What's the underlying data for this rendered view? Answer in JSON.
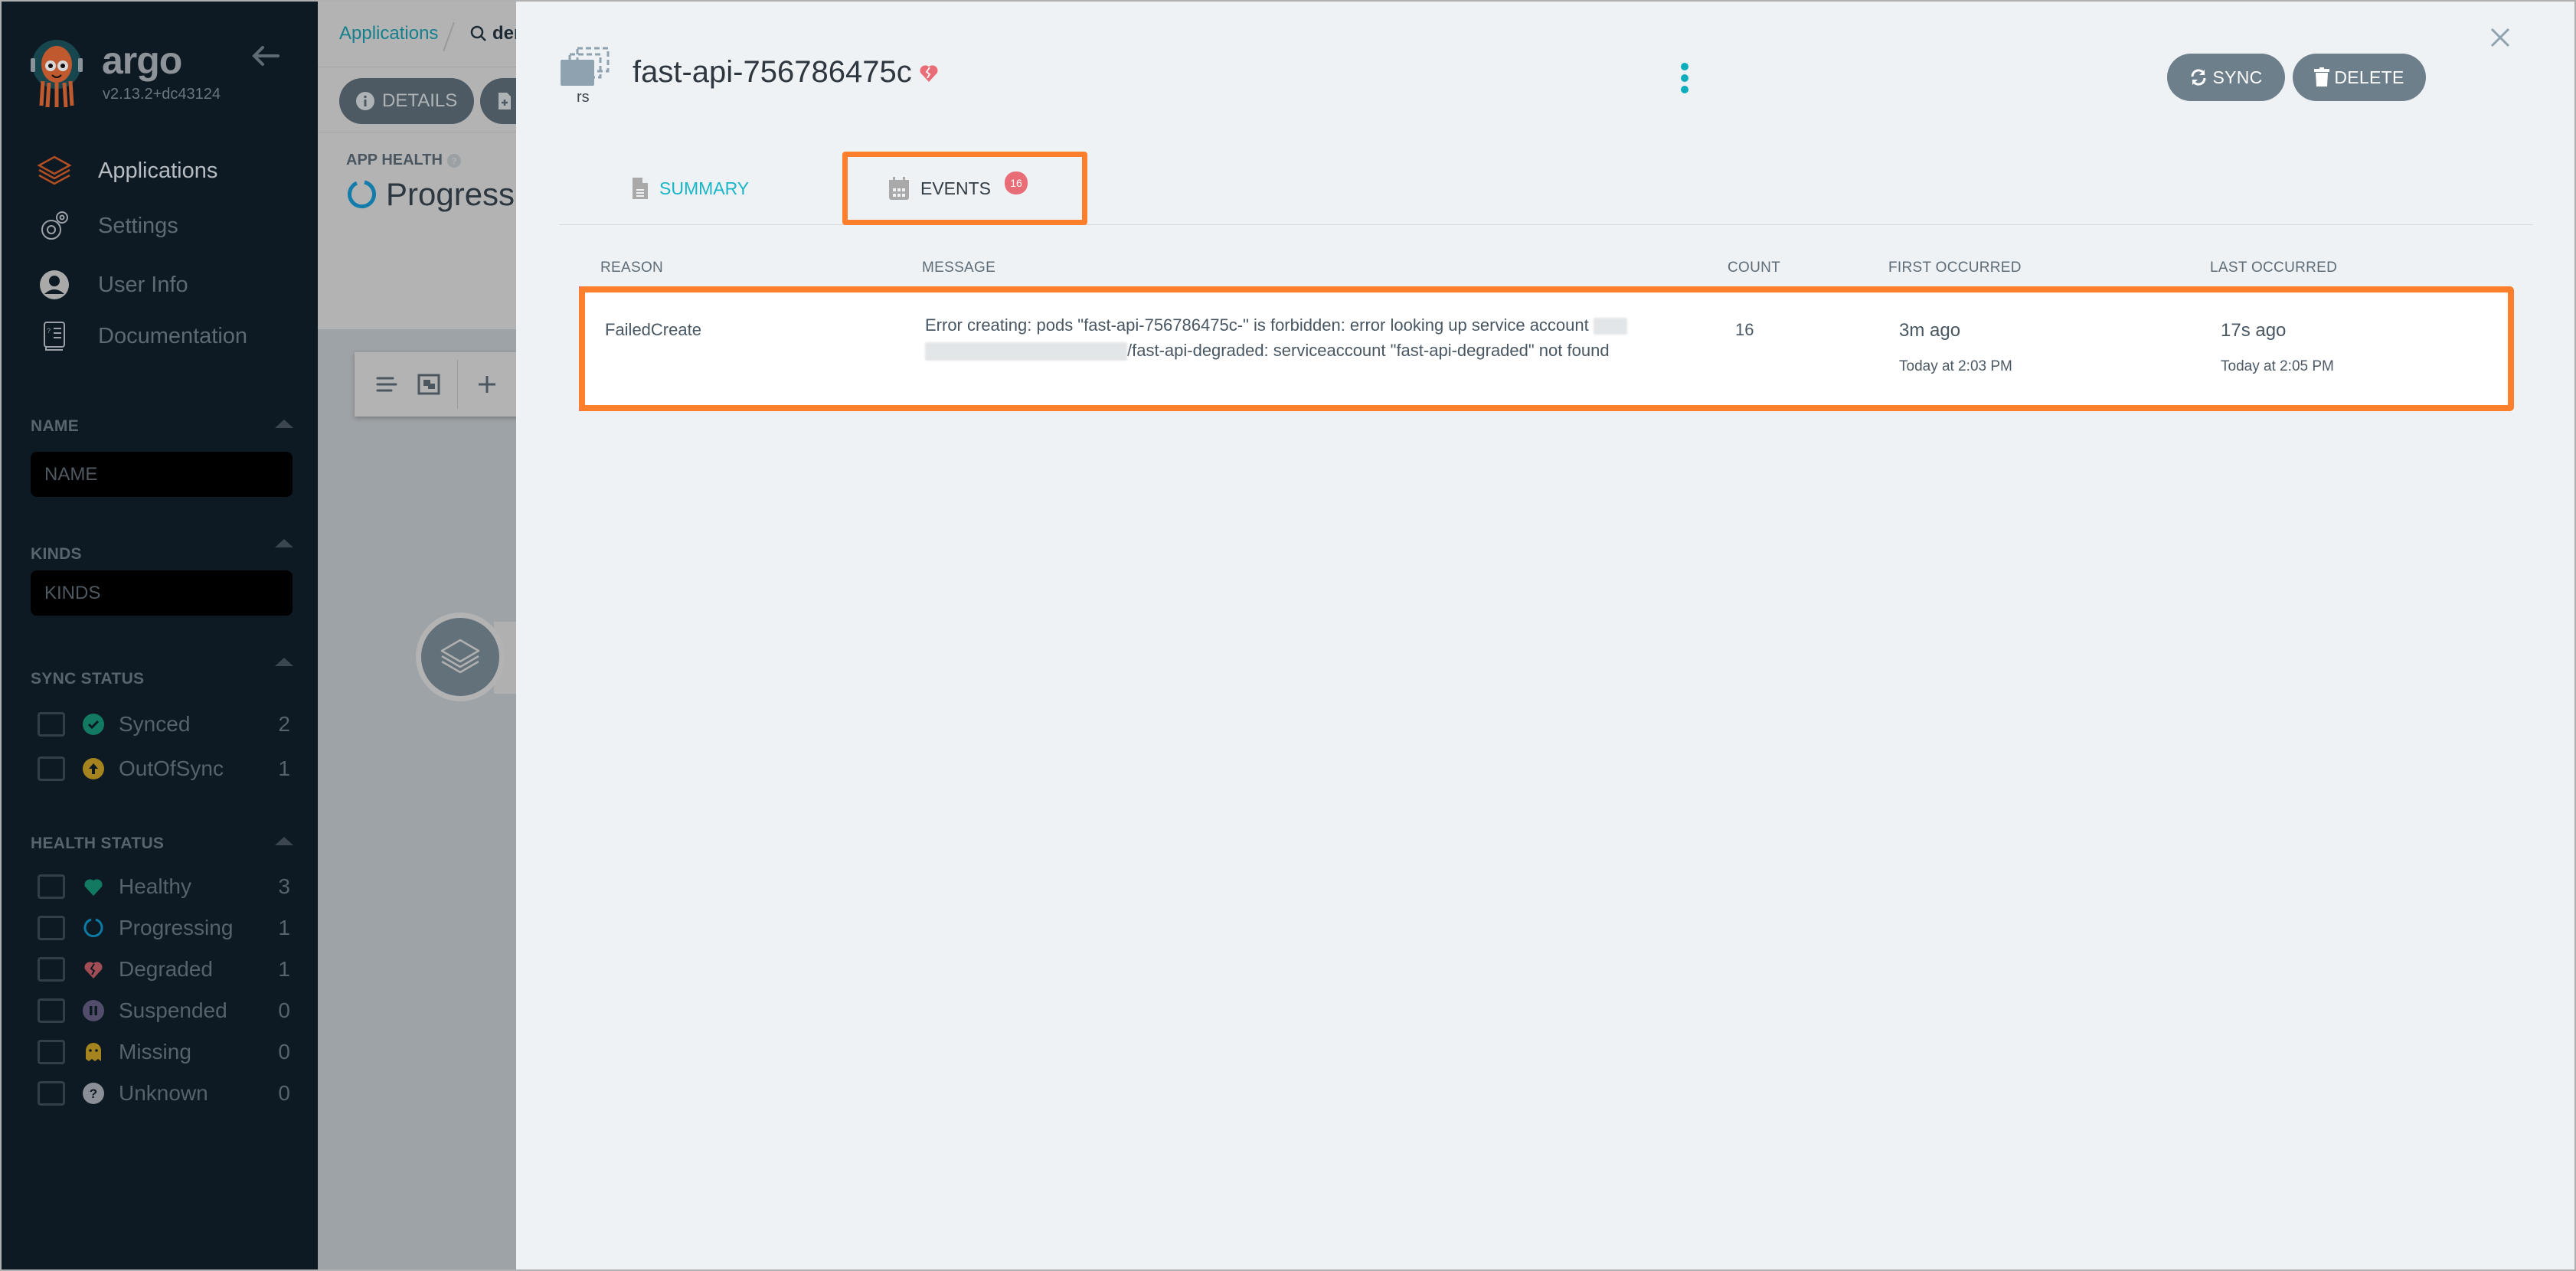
{
  "sidebar": {
    "brand": "argo",
    "version": "v2.13.2+dc43124",
    "nav": [
      {
        "label": "Applications",
        "icon": "layers-icon",
        "active": true
      },
      {
        "label": "Settings",
        "icon": "gears-icon",
        "active": false
      },
      {
        "label": "User Info",
        "icon": "user-circle-icon",
        "active": false
      },
      {
        "label": "Documentation",
        "icon": "book-icon",
        "active": false
      }
    ],
    "filters": {
      "name": {
        "title": "NAME",
        "placeholder": "NAME"
      },
      "kinds": {
        "title": "KINDS",
        "placeholder": "KINDS"
      },
      "sync_status": {
        "title": "SYNC STATUS",
        "items": [
          {
            "label": "Synced",
            "count": "2",
            "color": "#18be94"
          },
          {
            "label": "OutOfSync",
            "count": "1",
            "color": "#f4c030"
          }
        ]
      },
      "health_status": {
        "title": "HEALTH STATUS",
        "items": [
          {
            "label": "Healthy",
            "count": "3",
            "color": "#18be94"
          },
          {
            "label": "Progressing",
            "count": "1",
            "color": "#0dadea"
          },
          {
            "label": "Degraded",
            "count": "1",
            "color": "#e96d76"
          },
          {
            "label": "Suspended",
            "count": "0",
            "color": "#766f94"
          },
          {
            "label": "Missing",
            "count": "0",
            "color": "#f4c030"
          },
          {
            "label": "Unknown",
            "count": "0",
            "color": "#ccd6dd"
          }
        ]
      }
    }
  },
  "background_app": {
    "breadcrumb_root": "Applications",
    "breadcrumb_search": "der",
    "details_button": "DETAILS",
    "app_health_label": "APP HEALTH",
    "app_health_value": "Progressing"
  },
  "panel": {
    "resource_kind": "rs",
    "resource_name": "fast-api-756786475c",
    "health": "Degraded",
    "buttons": {
      "sync": "SYNC",
      "delete": "DELETE"
    },
    "tabs": [
      {
        "label": "SUMMARY",
        "active": false
      },
      {
        "label": "EVENTS",
        "active": true,
        "badge": "16"
      }
    ],
    "events": {
      "columns": [
        "REASON",
        "MESSAGE",
        "COUNT",
        "FIRST OCCURRED",
        "LAST OCCURRED"
      ],
      "rows": [
        {
          "reason": "FailedCreate",
          "message_part1": "Error creating: pods \"fast-api-756786475c-\" is forbidden: error looking up service account",
          "message_part2": "/fast-api-degraded: serviceaccount \"fast-api-degraded\" not found",
          "count": "16",
          "first_relative": "3m ago",
          "first_absolute": "Today at 2:03 PM",
          "last_relative": "17s ago",
          "last_absolute": "Today at 2:05 PM",
          "type": "warning"
        }
      ]
    }
  },
  "annotation_color": "#fd7f2c"
}
